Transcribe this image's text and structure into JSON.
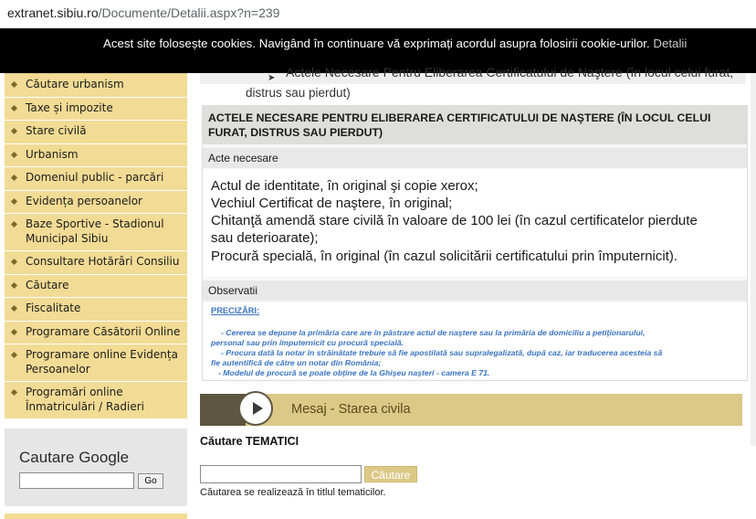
{
  "address_bar": {
    "host": "extranet.sibiu.ro",
    "path": "/Documente/Detalii.aspx?n=239"
  },
  "cookie_bar": {
    "text": "Acest site folosește cookies. Navigând în continuare vă exprimați acordul asupra folosirii cookie-urilor.",
    "link": "Detalii"
  },
  "sidebar": {
    "items": [
      {
        "label": "Căutare urbanism"
      },
      {
        "label": "Taxe și impozite"
      },
      {
        "label": "Stare civilă"
      },
      {
        "label": "Urbanism"
      },
      {
        "label": "Domeniul public - parcări"
      },
      {
        "label": "Evidența persoanelor"
      },
      {
        "label": "Baze Sportive - Stadionul Municipal Sibiu"
      },
      {
        "label": "Consultare Hotărâri Consiliu"
      },
      {
        "label": "Căutare"
      },
      {
        "label": "Fiscalitate"
      },
      {
        "label": "Programare Căsătorii Online"
      },
      {
        "label": "Programare online Evidența Persoanelor"
      },
      {
        "label": "Programări online Înmatriculări / Radieri"
      }
    ],
    "google": {
      "title": "Cautare Google",
      "button": "Go"
    }
  },
  "breadcrumb": {
    "line1": "Actele Necesare Pentru Eliberarea Certificatului de Naştere (în locul celui furat,",
    "line2": "distrus sau pierdut)"
  },
  "document": {
    "title": "ACTELE NECESARE PENTRU ELIBERAREA CERTIFICATULUI DE NAŞTERE (ÎN LOCUL CELUI FURAT, DISTRUS SAU PIERDUT)",
    "acte_label": "Acte necesare",
    "acte_lines": [
      "Actul de identitate, în original şi copie xerox;",
      "Vechiul Certificat de naştere, în original;",
      "Chitanţă amendă stare civilă în valoare de 100 lei (în cazul certificatelor pierdute",
      "sau deterioarate);",
      "Procură specială, în original (în cazul solicitării certificatului prin împuternicit)."
    ],
    "obs_label": "Observatii",
    "precizari": "PRECIZĂRI:",
    "obs_lines": [
      "- Cererea se depune la primăria care are în păstrare actul de naştere sau la primăria de domiciliu a petiţionarului,",
      "personal sau prin împuternicit cu procură specială.",
      "- Procura dată la notar în străinătate trebuie să fie apostilată sau supralegalizată, după caz, iar traducerea acesteia să",
      "fie autentifică de către un notar din România;",
      "- Modelul de procură se poate obţine de la Ghişeu naşteri - camera E 71."
    ]
  },
  "mesaj": {
    "text": "Mesaj - Starea civila"
  },
  "search": {
    "title": "Căutare TEMATICI",
    "button": "Căutare",
    "note": "Căutarea se realizează în titlul tematicilor."
  }
}
